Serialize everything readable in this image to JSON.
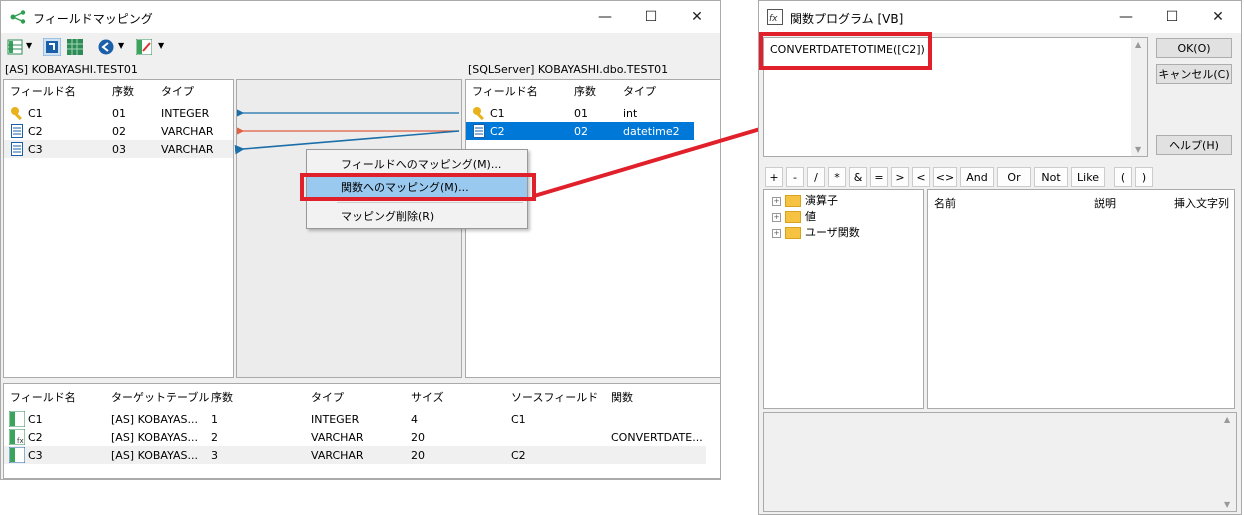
{
  "left_window": {
    "title": "フィールドマッピング",
    "controls": {
      "minimize": "—",
      "maximize": "☐",
      "close": "✕"
    },
    "source_label": "[AS] KOBAYASHI.TEST01",
    "target_label": "[SQLServer] KOBAYASHI.dbo.TEST01",
    "source_headers": [
      "フィールド名",
      "序数",
      "タイプ"
    ],
    "source_rows": [
      {
        "name": "C1",
        "ord": "01",
        "type": "INTEGER",
        "icon": "key-icon"
      },
      {
        "name": "C2",
        "ord": "02",
        "type": "VARCHAR",
        "icon": "field-icon"
      },
      {
        "name": "C3",
        "ord": "03",
        "type": "VARCHAR",
        "icon": "field-icon"
      }
    ],
    "target_headers": [
      "フィールド名",
      "序数",
      "タイプ"
    ],
    "target_rows": [
      {
        "name": "C1",
        "ord": "01",
        "type": "int",
        "icon": "key-icon"
      },
      {
        "name": "C2",
        "ord": "02",
        "type": "datetime2",
        "icon": "field-icon"
      }
    ],
    "context_menu": [
      "フィールドへのマッピング(M)...",
      "関数へのマッピング(M)...",
      "マッピング削除(R)"
    ],
    "bottom_headers": [
      "フィールド名",
      "ターゲットテーブル",
      "序数",
      "タイプ",
      "サイズ",
      "ソースフィールド",
      "関数"
    ],
    "bottom_rows": [
      [
        "C1",
        "[AS] KOBAYAS...",
        "1",
        "INTEGER",
        "4",
        "C1",
        ""
      ],
      [
        "C2",
        "[AS] KOBAYAS...",
        "2",
        "VARCHAR",
        "20",
        "",
        "CONVERTDATE..."
      ],
      [
        "C3",
        "[AS] KOBAYAS...",
        "3",
        "VARCHAR",
        "20",
        "C2",
        ""
      ]
    ]
  },
  "right_window": {
    "title": "関数プログラム [VB]",
    "controls": {
      "minimize": "—",
      "maximize": "☐",
      "close": "✕"
    },
    "expression": "CONVERTDATETOTIME([C2])",
    "buttons": {
      "ok": "OK(O)",
      "cancel": "キャンセル(C)",
      "help": "ヘルプ(H)"
    },
    "operators": [
      "+",
      "-",
      "/",
      "*",
      "&",
      "=",
      ">",
      "<",
      "<>",
      "And",
      "Or",
      "Not",
      "Like",
      "(",
      ")"
    ],
    "tree": [
      "演算子",
      "値",
      "ユーザ関数"
    ],
    "list_headers": [
      "名前",
      "説明",
      "挿入文字列"
    ]
  },
  "colors": {
    "highlight": "#e0202a",
    "selection": "#0078d7",
    "menu_highlight": "#99c9ef",
    "arrow_blue": "#1a6fa8",
    "arrow_red": "#e06040"
  }
}
